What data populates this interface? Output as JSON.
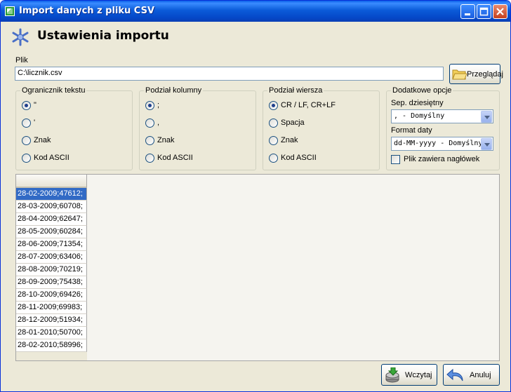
{
  "window": {
    "title": "Import danych z pliku CSV",
    "minimize": "_",
    "maximize": "□",
    "close": "×"
  },
  "header": {
    "title": "Ustawienia importu",
    "icon": "asterisk-settings-icon"
  },
  "file": {
    "label": "Plik",
    "value": "C:\\licznik.csv",
    "browse_label": "Przeglądaj",
    "browse_icon": "folder-icon"
  },
  "text_qualifier": {
    "title": "Ogranicznik tekstu",
    "options": [
      "\"",
      "'",
      "Znak",
      "Kod ASCII"
    ],
    "selected": 0
  },
  "column_split": {
    "title": "Podział kolumny",
    "options": [
      ";",
      ",",
      "Znak",
      "Kod ASCII"
    ],
    "selected": 0
  },
  "row_split": {
    "title": "Podział wiersza",
    "options": [
      "CR / LF, CR+LF",
      "Spacja",
      "Znak",
      "Kod ASCII"
    ],
    "selected": 0
  },
  "extra": {
    "title": "Dodatkowe opcje",
    "decimal_label": "Sep. dziesiętny",
    "decimal_value": ", - Domyślny",
    "date_label": "Format daty",
    "date_value": "dd-MM-yyyy - Domyślny",
    "header_checkbox_label": "Plik zawiera nagłówek",
    "header_checkbox_checked": false
  },
  "grid": {
    "header": "",
    "rows": [
      "28-02-2009;47612;",
      "28-03-2009;60708;",
      "28-04-2009;62647;",
      "28-05-2009;60284;",
      "28-06-2009;71354;",
      "28-07-2009;63406;",
      "28-08-2009;70219;",
      "28-09-2009;75438;",
      "28-10-2009;69426;",
      "28-11-2009;69983;",
      "28-12-2009;51934;",
      "28-01-2010;50700;",
      "28-02-2010;58996;"
    ],
    "selected_row": 0
  },
  "footer": {
    "load_label": "Wczytaj",
    "cancel_label": "Anuluj"
  }
}
